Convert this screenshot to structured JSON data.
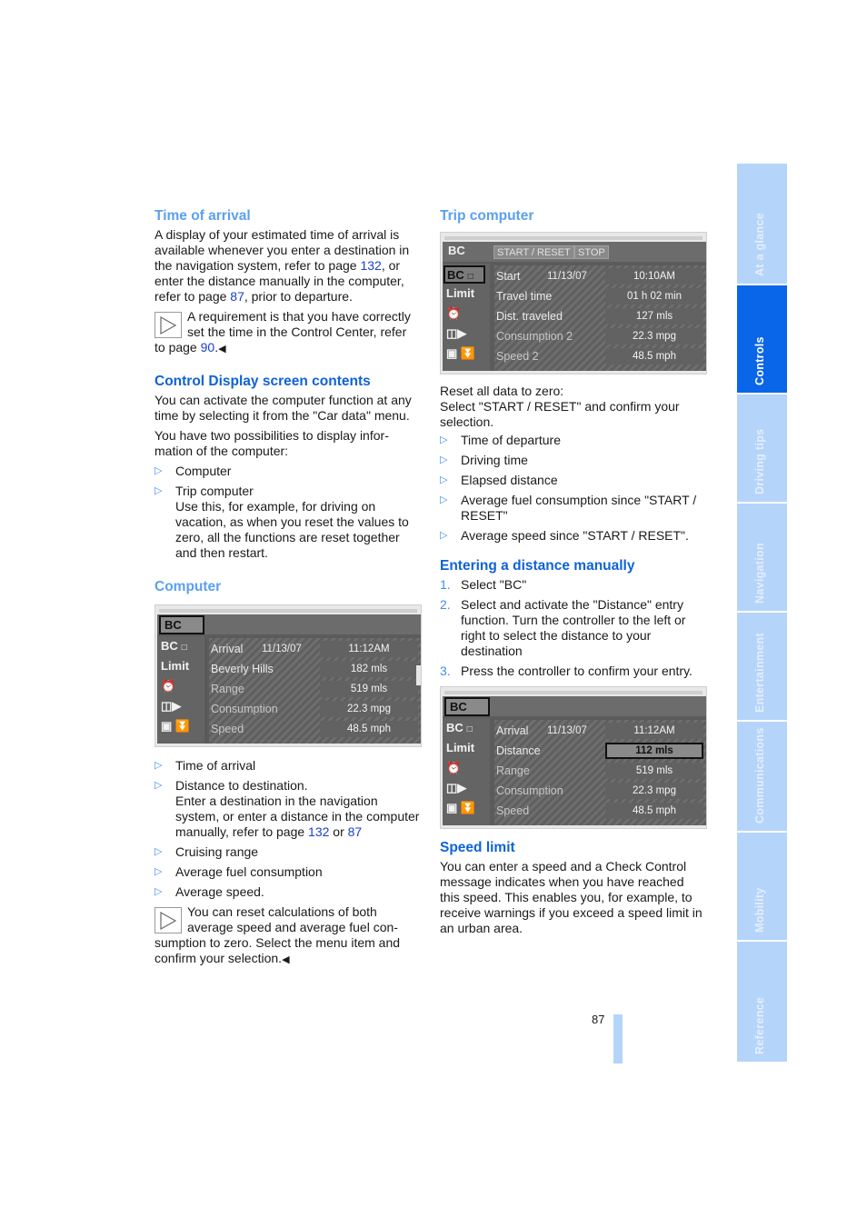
{
  "left": {
    "time_of_arrival": {
      "heading": "Time of arrival",
      "para": [
        "A display of your estimated time of arrival is available whenever you enter a destination in the navigation system, refer to page ",
        "132",
        ", or enter the distance manually in the com­puter, refer to page ",
        "87",
        ", prior to departure."
      ],
      "note": [
        "A requirement is that you have cor­rectly set the time in the Control Cen­ter, refer to page ",
        "90",
        "."
      ]
    },
    "control_display": {
      "heading": "Control Display screen contents",
      "para1": "You can activate the computer function at any time by selecting it from the \"Car data\" menu.",
      "para2": "You have two possibilities to display infor­mation of the computer:",
      "items": [
        {
          "title": "Computer",
          "desc": ""
        },
        {
          "title": "Trip computer",
          "desc": "Use this, for example, for driving on vacation, as when you reset the values to zero, all the functions are reset together and then restart."
        }
      ]
    },
    "computer": {
      "heading": "Computer",
      "screen": {
        "header": "BC",
        "side": [
          "BC",
          "Limit"
        ],
        "rows": [
          {
            "label": "Arrival",
            "date": "11/13/07",
            "value": "11:12AM"
          },
          {
            "label": "Beverly Hills",
            "date": "",
            "value": "182 mls"
          },
          {
            "label": "Range",
            "date": "",
            "value": "519 mls"
          },
          {
            "label": "Consumption",
            "date": "",
            "value": "22.3 mpg"
          },
          {
            "label": "Speed",
            "date": "",
            "value": "48.5 mph"
          }
        ]
      },
      "items": [
        "Time of arrival",
        "Distance to destination.",
        "Cruising range",
        "Average fuel consumption",
        "Average speed."
      ],
      "distance_desc": [
        "Enter a destination in the navigation system, or enter a distance in the com­puter manually, refer to page ",
        "132",
        " or ",
        "87"
      ],
      "note": "You can reset calculations of both average speed and average fuel con­sumption to zero. Select the menu item and confirm your selection."
    }
  },
  "right": {
    "trip_computer": {
      "heading": "Trip computer",
      "screen": {
        "header": "BC",
        "buttons": [
          "START / RESET",
          "STOP"
        ],
        "side": [
          "BC",
          "Limit"
        ],
        "rows": [
          {
            "label": "Start",
            "date": "11/13/07",
            "value": "10:10AM"
          },
          {
            "label": "Travel time",
            "date": "",
            "value": "01 h 02 min"
          },
          {
            "label": "Dist. traveled",
            "date": "",
            "value": "127 mls"
          },
          {
            "label": "Consumption 2",
            "date": "",
            "value": "22.3 mpg"
          },
          {
            "label": "Speed 2",
            "date": "",
            "value": "48.5 mph"
          }
        ]
      },
      "reset_text": [
        "Reset all data to zero:",
        "Select \"START / RESET\" and confirm your selection."
      ],
      "items": [
        "Time of departure",
        "Driving time",
        "Elapsed distance",
        "Average fuel consumption since \"START / RESET\"",
        "Average speed since \"START / RESET\"."
      ]
    },
    "entering_distance": {
      "heading": "Entering a distance manually",
      "steps": [
        {
          "num": "1.",
          "text": "Select \"BC\""
        },
        {
          "num": "2.",
          "text": "Select and activate the \"Distance\" entry function. Turn the controller to the left or right to select the distance to your destination"
        },
        {
          "num": "3.",
          "text": "Press the controller to confirm your entry."
        }
      ],
      "screen": {
        "header": "BC",
        "side": [
          "BC",
          "Limit"
        ],
        "rows": [
          {
            "label": "Arrival",
            "date": "11/13/07",
            "value": "11:12AM"
          },
          {
            "label": "Distance",
            "date": "",
            "value": "112 mls"
          },
          {
            "label": "Range",
            "date": "",
            "value": "519 mls"
          },
          {
            "label": "Consumption",
            "date": "",
            "value": "22.3 mpg"
          },
          {
            "label": "Speed",
            "date": "",
            "value": "48.5 mph"
          }
        ]
      }
    },
    "speed_limit": {
      "heading": "Speed limit",
      "para": "You can enter a speed and a Check Control message indicates when you have reached this speed. This enables you, for example, to receive warnings if you exceed a speed limit in an urban area."
    }
  },
  "side_tabs": [
    {
      "label": "At a glance",
      "active": false
    },
    {
      "label": "Controls",
      "active": true
    },
    {
      "label": "Driving tips",
      "active": false
    },
    {
      "label": "Navigation",
      "active": false
    },
    {
      "label": "Entertainment",
      "active": false
    },
    {
      "label": "Communications",
      "active": false
    },
    {
      "label": "Mobility",
      "active": false
    },
    {
      "label": "Reference",
      "active": false
    }
  ],
  "symbols": {
    "bullet": "▷",
    "end_mark": "◀"
  },
  "colors": {
    "heading": "#0f62d8",
    "heading_light": "#5aa0f0",
    "link": "#1a3fd0",
    "tab": "#b5d4f9",
    "tab_active": "#0a66e8"
  },
  "page_number": "87"
}
